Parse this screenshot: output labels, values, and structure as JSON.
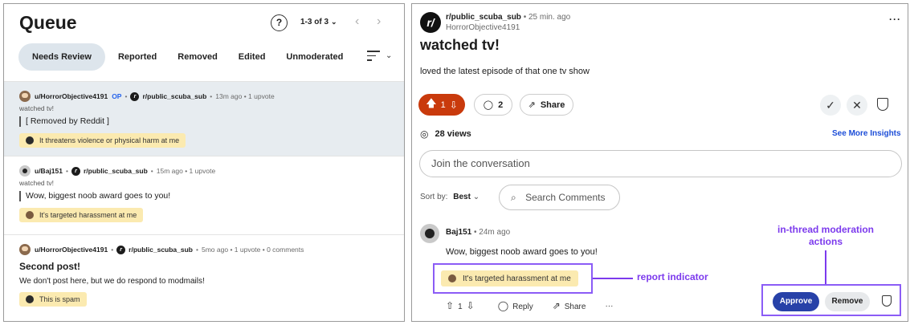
{
  "queue": {
    "title": "Queue",
    "help_glyph": "?",
    "pager": "1-3 of 3",
    "tabs": [
      "Needs Review",
      "Reported",
      "Removed",
      "Edited",
      "Unmoderated"
    ],
    "items": [
      {
        "user": "u/HorrorObjective4191",
        "op": "OP",
        "subreddit": "r/public_scuba_sub",
        "meta": "13m ago • 1 upvote",
        "post_title": "watched tv!",
        "quote": "[ Removed by Reddit ]",
        "report": "It threatens violence or physical harm at me"
      },
      {
        "user": "u/Baj151",
        "subreddit": "r/public_scuba_sub",
        "meta": "15m ago • 1 upvote",
        "post_title": "watched tv!",
        "quote": "Wow, biggest noob award goes to you!",
        "report": "It's targeted harassment at me"
      },
      {
        "user": "u/HorrorObjective4191",
        "subreddit": "r/public_scuba_sub",
        "meta": "5mo ago • 1 upvote • 0 comments",
        "title": "Second post!",
        "body": "We don't post here, but we do respond to modmails!",
        "report": "This is spam"
      }
    ]
  },
  "post": {
    "subreddit": "r/public_scuba_sub",
    "age": "• 25 min. ago",
    "author": "HorrorObjective4191",
    "title": "watched tv!",
    "body": "loved the latest episode of that one tv show",
    "votes": "1",
    "comments": "2",
    "share_label": "Share",
    "views": "28 views",
    "insights_label": "See More Insights"
  },
  "comments_area": {
    "join_placeholder": "Join the conversation",
    "sort_label": "Sort by:",
    "sort_value": "Best",
    "search_label": "Search Comments"
  },
  "comment": {
    "user": "Baj151",
    "age": "• 24m ago",
    "body": "Wow, biggest noob award goes to you!",
    "report": "It's targeted harassment at me",
    "votes": "1",
    "reply_label": "Reply",
    "share_label": "Share",
    "more": "···"
  },
  "annotations": {
    "report_indicator": "report indicator",
    "moderation_line1": "in-thread moderation",
    "moderation_line2": "actions"
  },
  "mod_actions": {
    "approve": "Approve",
    "remove": "Remove"
  },
  "colors": {
    "annotation": "#7c3aed",
    "upvote_active": "#c93a0c",
    "approve": "#2741a8",
    "report_pill": "#fbeab0",
    "selected_row": "#e7ecf0"
  }
}
